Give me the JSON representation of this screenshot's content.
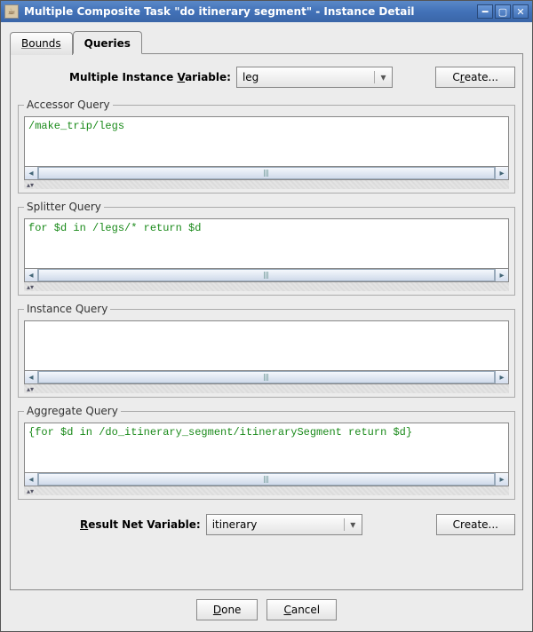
{
  "window": {
    "title": "Multiple Composite Task \"do itinerary segment\" - Instance Detail"
  },
  "tabs": {
    "bounds": "Bounds",
    "queries": "Queries"
  },
  "variable_row": {
    "label_pre": "Multiple Instance ",
    "label_mn": "V",
    "label_post": "ariable:",
    "value": "leg",
    "create_btn_pre": "C",
    "create_btn_mn": "r",
    "create_btn_post": "eate..."
  },
  "accessor": {
    "legend": "Accessor Query",
    "text": "/make_trip/legs"
  },
  "splitter": {
    "legend": "Splitter Query",
    "text": "for $d in /legs/* return $d"
  },
  "instance": {
    "legend": "Instance Query",
    "text": ""
  },
  "aggregate": {
    "legend": "Aggregate Query",
    "text": "{for $d in /do_itinerary_segment/itinerarySegment return $d}"
  },
  "result_row": {
    "label_mn": "R",
    "label_post": "esult Net Variable:",
    "value": "itinerary",
    "create_btn_pre": "Create..."
  },
  "buttons": {
    "done_mn": "D",
    "done_post": "one",
    "cancel_mn": "C",
    "cancel_post": "ancel"
  }
}
